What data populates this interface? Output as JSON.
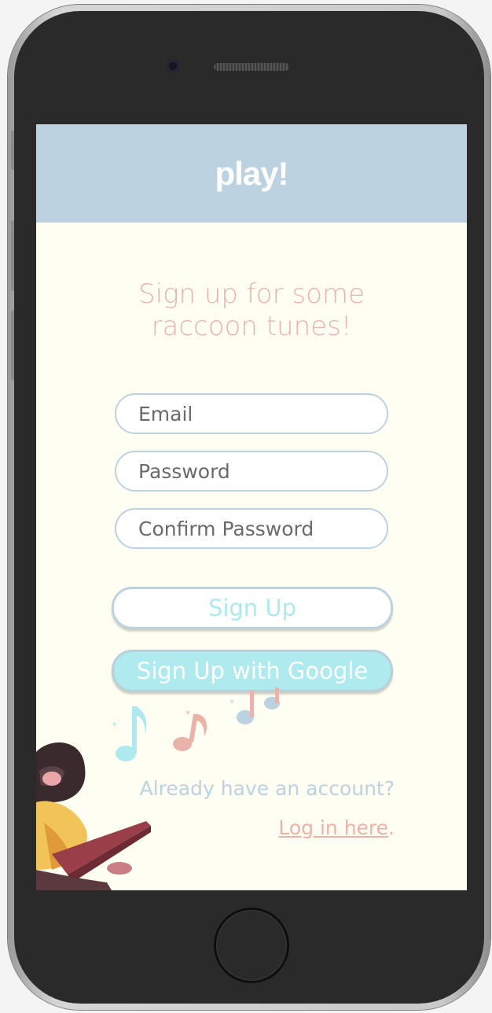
{
  "app": {
    "title": "play!"
  },
  "signup": {
    "headline_line1": "Sign up for some",
    "headline_line2": "raccoon tunes!",
    "email_placeholder": "Email",
    "password_placeholder": "Password",
    "confirm_placeholder": "Confirm Password",
    "signup_button": "Sign Up",
    "google_button": "Sign Up with Google"
  },
  "footer": {
    "already_text": "Already have an account?",
    "login_link": "Log in here",
    "login_suffix": "."
  },
  "colors": {
    "header_bg": "#bcd2e0",
    "screen_bg": "#fefef2",
    "accent_pink": "#eab3aa",
    "accent_cyan": "#aee9ee"
  },
  "icons": [
    "music-note-icon",
    "raccoon-illustration"
  ]
}
